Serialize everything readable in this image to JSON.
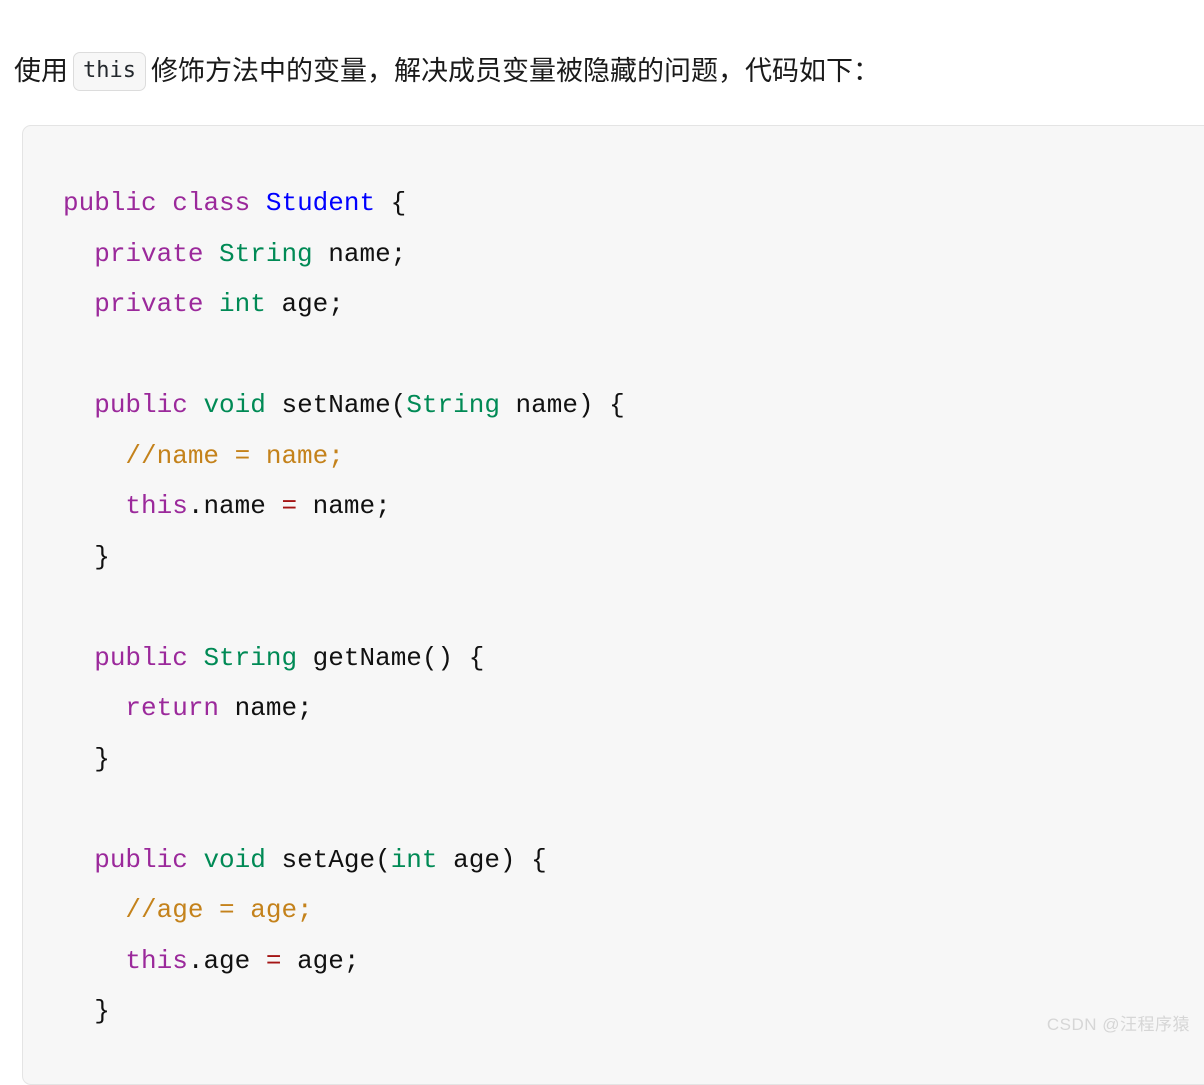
{
  "intro": {
    "before": "使用",
    "inline_code": "this",
    "after": "修饰方法中的变量，解决成员变量被隐藏的问题，代码如下："
  },
  "code_block": {
    "language": "java",
    "colors": {
      "keyword": "#9b299b",
      "type": "#008a55",
      "class_name": "#0000ff",
      "plain": "#111111",
      "comment": "#c4821b",
      "operator": "#a41515",
      "background": "#f7f7f7",
      "border": "#e4e4e4"
    },
    "lines": [
      {
        "tokens": [
          {
            "t": "public",
            "c": "kw"
          },
          {
            "t": " ",
            "c": "plain"
          },
          {
            "t": "class",
            "c": "kw"
          },
          {
            "t": " ",
            "c": "plain"
          },
          {
            "t": "Student",
            "c": "class"
          },
          {
            "t": " {",
            "c": "plain"
          }
        ]
      },
      {
        "tokens": [
          {
            "t": "  ",
            "c": "plain"
          },
          {
            "t": "private",
            "c": "kw"
          },
          {
            "t": " ",
            "c": "plain"
          },
          {
            "t": "String",
            "c": "type"
          },
          {
            "t": " name;",
            "c": "plain"
          }
        ]
      },
      {
        "tokens": [
          {
            "t": "  ",
            "c": "plain"
          },
          {
            "t": "private",
            "c": "kw"
          },
          {
            "t": " ",
            "c": "plain"
          },
          {
            "t": "int",
            "c": "type"
          },
          {
            "t": " age;",
            "c": "plain"
          }
        ]
      },
      {
        "tokens": []
      },
      {
        "tokens": [
          {
            "t": "  ",
            "c": "plain"
          },
          {
            "t": "public",
            "c": "kw"
          },
          {
            "t": " ",
            "c": "plain"
          },
          {
            "t": "void",
            "c": "type"
          },
          {
            "t": " setName(",
            "c": "plain"
          },
          {
            "t": "String",
            "c": "type"
          },
          {
            "t": " name) {",
            "c": "plain"
          }
        ]
      },
      {
        "tokens": [
          {
            "t": "    ",
            "c": "plain"
          },
          {
            "t": "//name = name;",
            "c": "comment"
          }
        ]
      },
      {
        "tokens": [
          {
            "t": "    ",
            "c": "plain"
          },
          {
            "t": "this",
            "c": "kw"
          },
          {
            "t": ".name ",
            "c": "plain"
          },
          {
            "t": "=",
            "c": "op"
          },
          {
            "t": " name;",
            "c": "plain"
          }
        ]
      },
      {
        "tokens": [
          {
            "t": "  }",
            "c": "plain"
          }
        ]
      },
      {
        "tokens": []
      },
      {
        "tokens": [
          {
            "t": "  ",
            "c": "plain"
          },
          {
            "t": "public",
            "c": "kw"
          },
          {
            "t": " ",
            "c": "plain"
          },
          {
            "t": "String",
            "c": "type"
          },
          {
            "t": " getName() {",
            "c": "plain"
          }
        ]
      },
      {
        "tokens": [
          {
            "t": "    ",
            "c": "plain"
          },
          {
            "t": "return",
            "c": "kw"
          },
          {
            "t": " name;",
            "c": "plain"
          }
        ]
      },
      {
        "tokens": [
          {
            "t": "  }",
            "c": "plain"
          }
        ]
      },
      {
        "tokens": []
      },
      {
        "tokens": [
          {
            "t": "  ",
            "c": "plain"
          },
          {
            "t": "public",
            "c": "kw"
          },
          {
            "t": " ",
            "c": "plain"
          },
          {
            "t": "void",
            "c": "type"
          },
          {
            "t": " setAge(",
            "c": "plain"
          },
          {
            "t": "int",
            "c": "type"
          },
          {
            "t": " age) {",
            "c": "plain"
          }
        ]
      },
      {
        "tokens": [
          {
            "t": "    ",
            "c": "plain"
          },
          {
            "t": "//age = age;",
            "c": "comment"
          }
        ]
      },
      {
        "tokens": [
          {
            "t": "    ",
            "c": "plain"
          },
          {
            "t": "this",
            "c": "kw"
          },
          {
            "t": ".age ",
            "c": "plain"
          },
          {
            "t": "=",
            "c": "op"
          },
          {
            "t": " age;",
            "c": "plain"
          }
        ]
      },
      {
        "tokens": [
          {
            "t": "  }",
            "c": "plain"
          }
        ]
      }
    ]
  },
  "watermark": {
    "text": "CSDN @汪程序猿"
  }
}
